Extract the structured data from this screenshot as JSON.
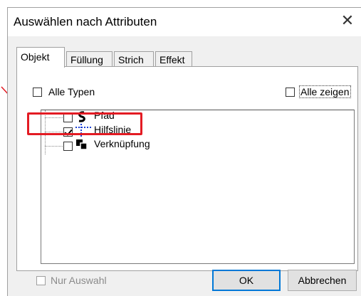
{
  "dialog": {
    "title": "Auswählen nach Attributen",
    "close_symbol": "✕"
  },
  "tabs": [
    {
      "label": "Objekt",
      "active": true
    },
    {
      "label": "Füllung",
      "active": false
    },
    {
      "label": "Strich",
      "active": false
    },
    {
      "label": "Effekt",
      "active": false
    }
  ],
  "options": {
    "all_types": {
      "label": "Alle Typen",
      "checked": false
    },
    "show_all": {
      "label": "Alle zeigen",
      "checked": false
    }
  },
  "tree_items": [
    {
      "label": "Pfad",
      "icon": "path-icon",
      "checked": false
    },
    {
      "label": "Hilfslinie",
      "icon": "guideline-icon",
      "checked": true
    },
    {
      "label": "Verknüpfung",
      "icon": "link-icon",
      "checked": false
    }
  ],
  "footer": {
    "only_selection": {
      "label": "Nur Auswahl",
      "checked": false,
      "disabled": true
    },
    "ok_label": "OK",
    "cancel_label": "Abbrechen"
  },
  "annotation": {
    "color": "#e31b23"
  }
}
